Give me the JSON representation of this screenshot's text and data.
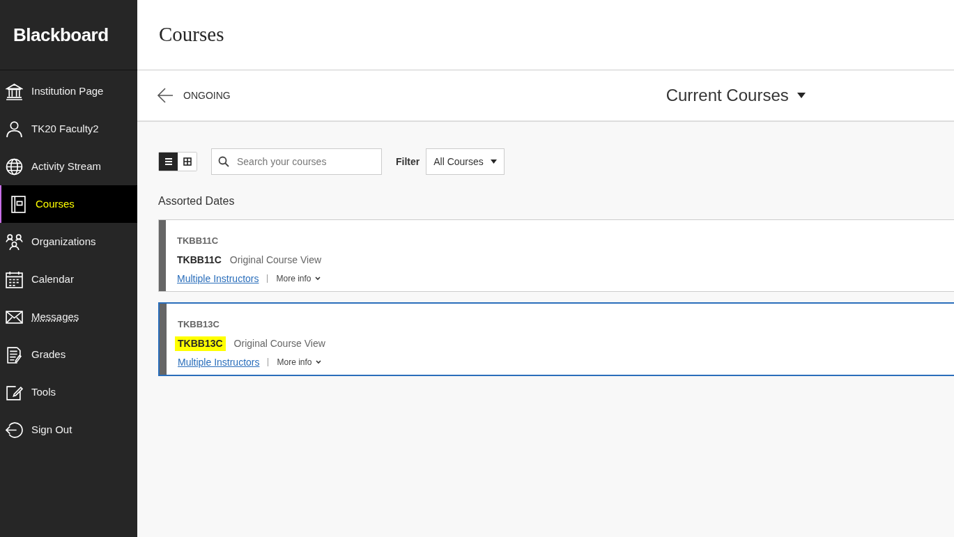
{
  "sidebar": {
    "logo": "Blackboard",
    "items": [
      {
        "kind": "institution",
        "label": "Institution Page",
        "selected": false,
        "underlined": false
      },
      {
        "kind": "person",
        "label": "TK20 Faculty2",
        "selected": false,
        "underlined": false
      },
      {
        "kind": "globe",
        "label": "Activity Stream",
        "selected": false,
        "underlined": false
      },
      {
        "kind": "courses",
        "label": "Courses",
        "selected": true,
        "underlined": false
      },
      {
        "kind": "organizations",
        "label": "Organizations",
        "selected": false,
        "underlined": false
      },
      {
        "kind": "calendar",
        "label": "Calendar",
        "selected": false,
        "underlined": false
      },
      {
        "kind": "messages",
        "label": "Messages",
        "selected": false,
        "underlined": true
      },
      {
        "kind": "grades",
        "label": "Grades",
        "selected": false,
        "underlined": false
      },
      {
        "kind": "tools",
        "label": "Tools",
        "selected": false,
        "underlined": false
      },
      {
        "kind": "signout",
        "label": "Sign Out",
        "selected": false,
        "underlined": false
      }
    ]
  },
  "page_title": "Courses",
  "subheader": {
    "back_label": "ONGOING",
    "term": "Current Courses"
  },
  "toolbar": {
    "views": [
      {
        "kind": "list",
        "selected": true
      },
      {
        "kind": "grid",
        "selected": false
      }
    ],
    "search": {
      "placeholder": "Search your courses"
    },
    "filter_label": "Filter",
    "filter_value": "All Courses"
  },
  "group_title": "Assorted Dates",
  "courses": [
    {
      "id": "TKBB11C",
      "name": "TKBB11C",
      "view": "Original Course View",
      "instructors": "Multiple Instructors",
      "more": "More info",
      "selected": false,
      "highlighted": false
    },
    {
      "id": "TKBB13C",
      "name": "TKBB13C",
      "view": "Original Course View",
      "instructors": "Multiple Instructors",
      "more": "More info",
      "selected": true,
      "highlighted": true
    }
  ]
}
